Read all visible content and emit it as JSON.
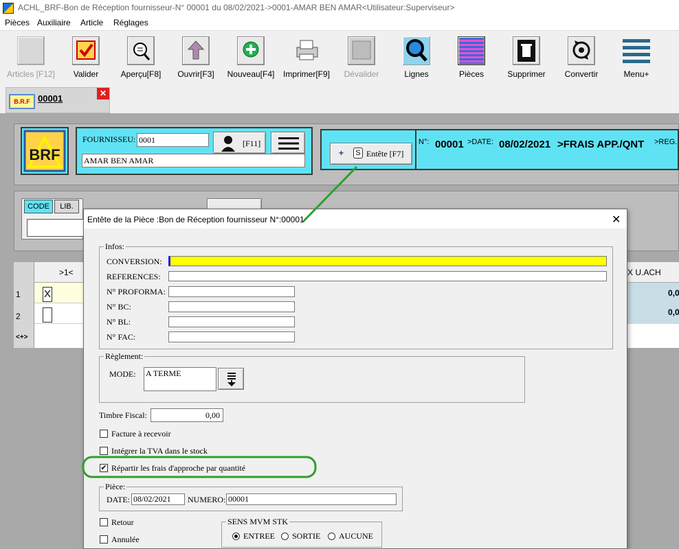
{
  "window": {
    "title": "ACHL_BRF-Bon de Réception fournisseur-N° 00001 du 08/02/2021->0001-AMAR BEN AMAR<Utilisateur:Superviseur>"
  },
  "menu": [
    "Pièces",
    "Auxiliaire",
    "Article",
    "Réglages"
  ],
  "toolbar": [
    {
      "label": "Articles [F12]",
      "icon": "articles-icon",
      "disabled": true
    },
    {
      "label": "Valider",
      "icon": "checkmark-icon"
    },
    {
      "label": "Aperçu[F8]",
      "icon": "preview-icon"
    },
    {
      "label": "Ouvrir[F3]",
      "icon": "open-arrow-icon"
    },
    {
      "label": "Nouveau[F4]",
      "icon": "new-plus-icon"
    },
    {
      "label": "Imprimer[F9]",
      "icon": "printer-icon"
    },
    {
      "label": "Dévalider",
      "icon": "unvalidate-icon",
      "disabled": true
    },
    {
      "label": "Lignes",
      "icon": "magnifier-icon"
    },
    {
      "label": "Pièces",
      "icon": "pieces-grid-icon"
    },
    {
      "label": "Supprimer",
      "icon": "trash-icon"
    },
    {
      "label": "Convertir",
      "icon": "convert-icon"
    },
    {
      "label": "Menu+",
      "icon": "menu-lines-icon"
    }
  ],
  "doc_tab": {
    "icon_text": "B.R.F",
    "label": "00001"
  },
  "supplier": {
    "label": "FOURNISSEU:",
    "code": "0001",
    "name": "AMAR BEN AMAR",
    "f11": "[F11]"
  },
  "logo_text": "BRF",
  "entete_button": {
    "plus": "+",
    "s": "S",
    "label": "Entête [F7]"
  },
  "info_strip": {
    "n_label": "N°:",
    "number": "00001",
    "date_label": ">DATE:",
    "date": "08/02/2021",
    "frais": ">FRAIS APP./QNT",
    "reg": ">REG."
  },
  "filter": {
    "code_tab": "CODE",
    "lib_tab": "LIB."
  },
  "grid": {
    "col_header": ">1<",
    "col_right": "X U.ACH",
    "rows": [
      {
        "num": "1",
        "check": "X",
        "value": "0,0"
      },
      {
        "num": "2",
        "check": "",
        "value": "0,0"
      }
    ],
    "nav": "<+>"
  },
  "dialog": {
    "title": "Entête de la Pièce :Bon de Réception fournisseur N°:00001",
    "infos": {
      "title": "Infos:",
      "conversion_label": "CONVERSION:",
      "references_label": "REFERENCES:",
      "proforma_label": "N° PROFORMA:",
      "bc_label": "N° BC:",
      "bl_label": "N° BL:",
      "fac_label": "N° FAC:"
    },
    "reglement": {
      "title": "Règlement:",
      "mode_label": "MODE:",
      "mode_value": "A TERME"
    },
    "timbre": {
      "label": "Timbre Fiscal:",
      "value": "0,00"
    },
    "checks": {
      "facture": "Facture à recevoir",
      "tva": "Intégrer la TVA dans le stock",
      "repartir": "Répartir les frais d'approche par quantité"
    },
    "piece": {
      "title": "Pièce:",
      "date_label": "DATE:",
      "date_value": "08/02/2021",
      "numero_label": "NUMERO:",
      "numero_value": "00001"
    },
    "retour": "Retour",
    "annulee": "Annulée",
    "sens": {
      "title": "SENS MVM STK",
      "entree": "ENTREE",
      "sortie": "SORTIE",
      "aucune": "AUCUNE"
    }
  },
  "colors": {
    "cyan_panel": "#5fe3f4",
    "highlight_green": "#2ca02c",
    "conversion_yellow": "#ffff00"
  }
}
